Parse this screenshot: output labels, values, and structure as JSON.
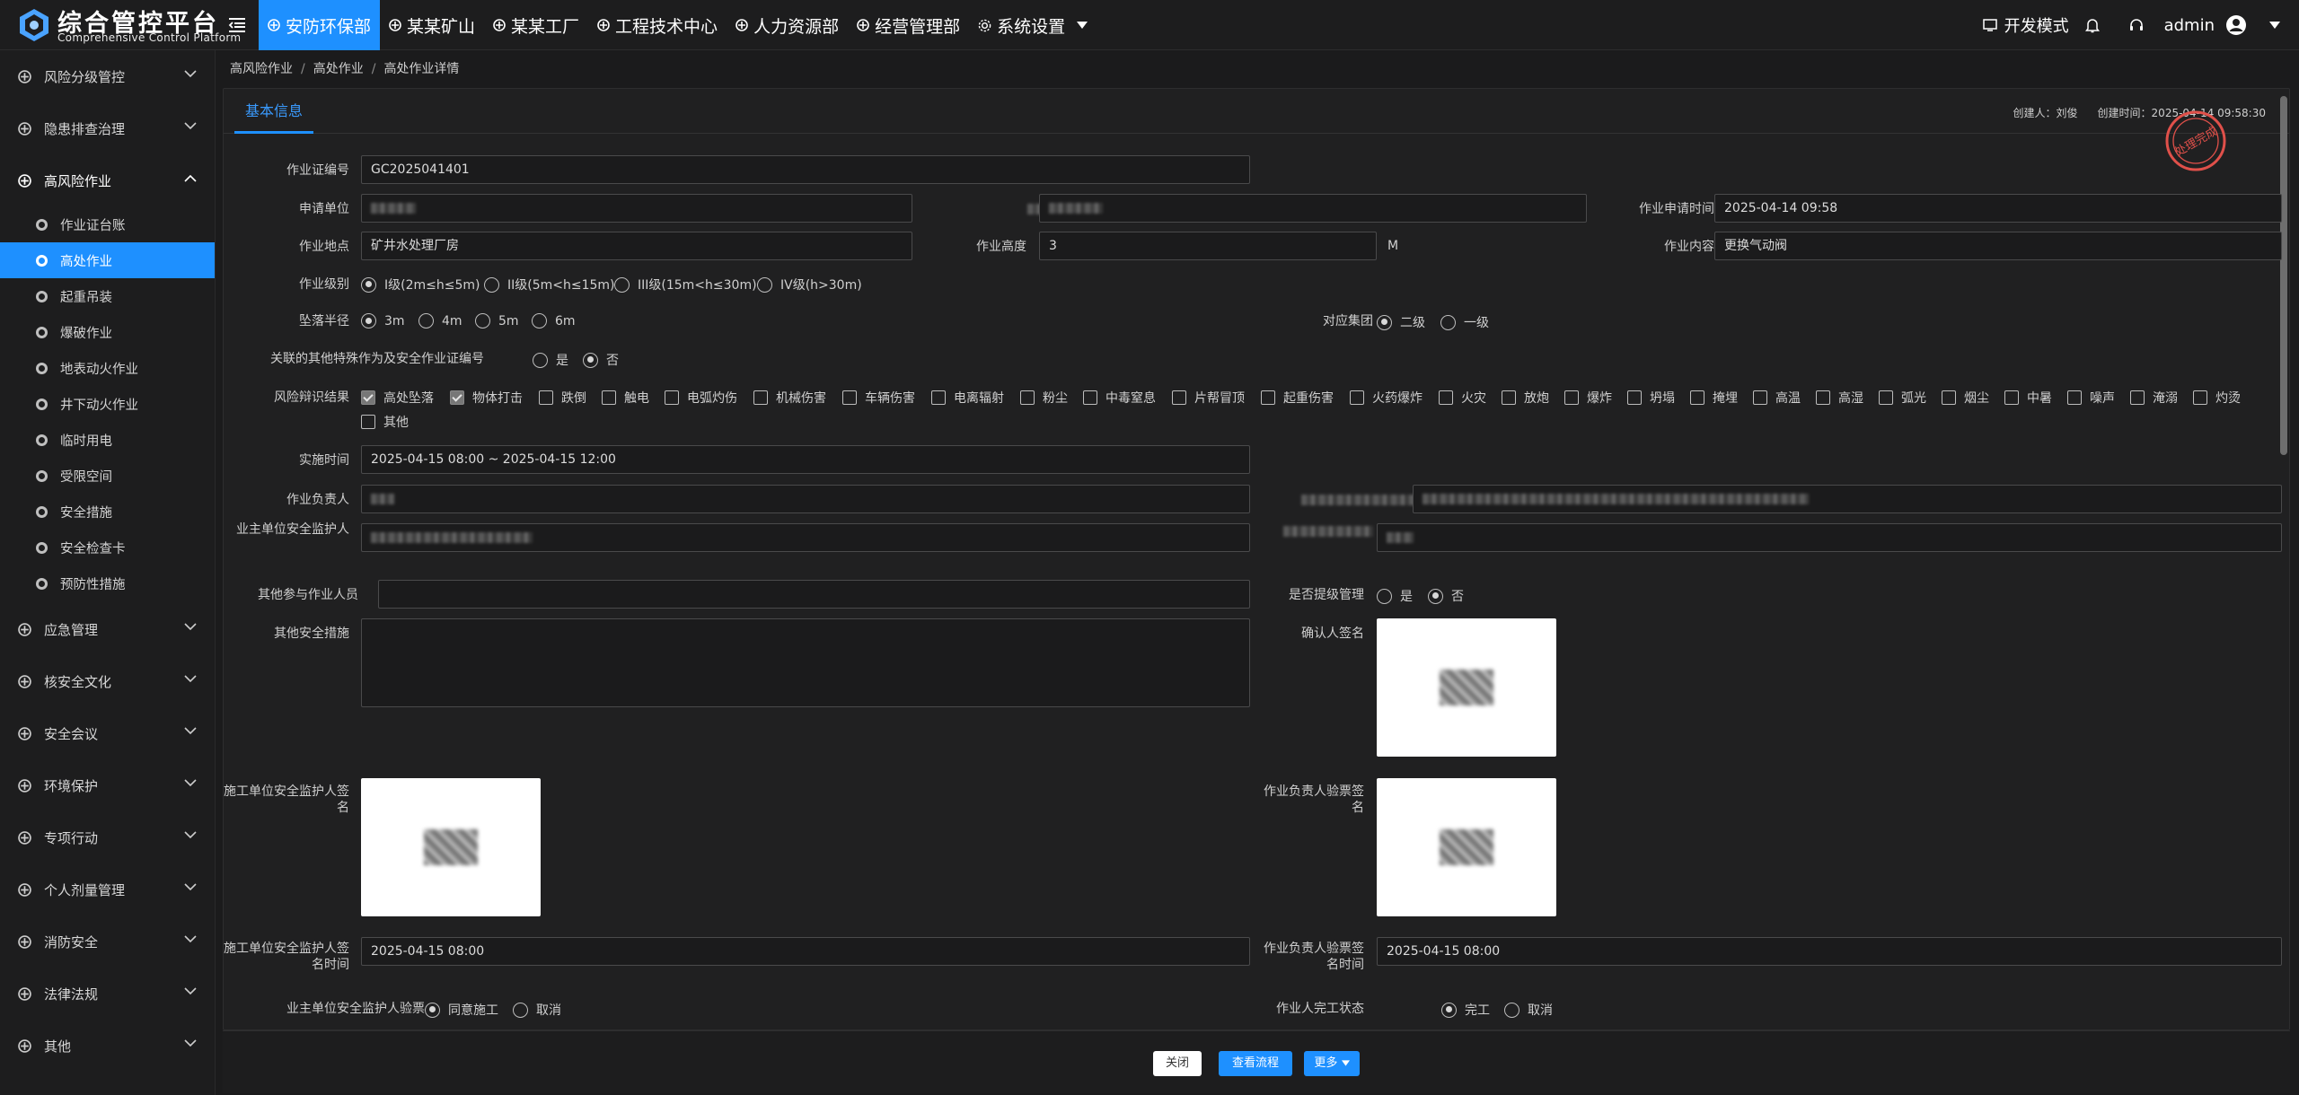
{
  "app": {
    "title": "综合管控平台",
    "subtitle": "Comprehensive Control Platform"
  },
  "nav": [
    {
      "label": "安防环保部",
      "active": true
    },
    {
      "label": "某某矿山"
    },
    {
      "label": "某某工厂"
    },
    {
      "label": "工程技术中心"
    },
    {
      "label": "人力资源部"
    },
    {
      "label": "经营管理部"
    },
    {
      "label": "系统设置"
    }
  ],
  "topright": {
    "dev_mode": "开发模式",
    "user": "admin"
  },
  "sidebar": {
    "groups_top": [
      "风险分级管控",
      "隐患排查治理",
      "高风险作业"
    ],
    "items": [
      "作业证台账",
      "高处作业",
      "起重吊装",
      "爆破作业",
      "地表动火作业",
      "井下动火作业",
      "临时用电",
      "受限空间",
      "安全措施",
      "安全检查卡",
      "预防性措施"
    ],
    "groups_bottom": [
      "应急管理",
      "核安全文化",
      "安全会议",
      "环境保护",
      "专项行动",
      "个人剂量管理",
      "消防安全",
      "法律法规",
      "其他"
    ]
  },
  "breadcrumb": [
    "高风险作业",
    "高处作业",
    "高处作业详情"
  ],
  "tab": "基本信息",
  "meta": {
    "creator": "创建人：刘俊",
    "created": "创建时间：2025-04-14 09:58:30"
  },
  "stamp": "处理完成",
  "form": {
    "cert_no": {
      "label": "作业证编号",
      "value": "GC2025041401"
    },
    "apply_unit": {
      "label": "申请单位"
    },
    "apply_time": {
      "label": "作业申请时间",
      "value": "2025-04-14 09:58"
    },
    "location": {
      "label": "作业地点",
      "value": "矿井水处理厂房"
    },
    "height": {
      "label": "作业高度",
      "value": "3",
      "unit": "M"
    },
    "content": {
      "label": "作业内容",
      "value": "更换气动阀"
    },
    "level": {
      "label": "作业级别",
      "options": [
        "I级(2m≤h≤5m)",
        "II级(5m<h≤15m)",
        "III级(15m<h≤30m)",
        "IV级(h>30m)"
      ]
    },
    "radius": {
      "label": "坠落半径",
      "options": [
        "3m",
        "4m",
        "5m",
        "6m"
      ]
    },
    "group": {
      "label": "对应集团",
      "options": [
        "二级",
        "一级"
      ]
    },
    "related": {
      "label": "关联的其他特殊作为及安全作业证编号",
      "options": [
        "是",
        "否"
      ]
    },
    "risk": {
      "label": "风险辩识结果",
      "options": [
        "高处坠落",
        "物体打击",
        "跌倒",
        "触电",
        "电弧灼伤",
        "机械伤害",
        "车辆伤害",
        "电离辐射",
        "粉尘",
        "中毒窒息",
        "片帮冒顶",
        "起重伤害",
        "火药爆炸",
        "火灾",
        "放炮",
        "爆炸",
        "坍塌",
        "掩埋",
        "高温",
        "高湿",
        "弧光",
        "烟尘",
        "中暑",
        "噪声",
        "淹溺",
        "灼烫",
        "其他"
      ]
    },
    "impl_time": {
      "label": "实施时间",
      "value": "2025-04-15 08:00 ~ 2025-04-15 12:00"
    },
    "leader": {
      "label": "作业负责人"
    },
    "owner_guard": {
      "label": "业主单位安全监护人"
    },
    "others": {
      "label": "其他参与作业人员"
    },
    "upgrade": {
      "label": "是否提级管理",
      "options": [
        "是",
        "否"
      ]
    },
    "other_measures": {
      "label": "其他安全措施"
    },
    "confirm_sign": {
      "label": "确认人签名"
    },
    "constr_sign": {
      "label": "施工单位安全监护人签名"
    },
    "leader_sign": {
      "label": "作业负责人验票签名"
    },
    "constr_sign_time": {
      "label": "施工单位安全监护人签名时间",
      "value": "2025-04-15 08:00"
    },
    "leader_sign_time": {
      "label": "作业负责人验票签名时间",
      "value": "2025-04-15 08:00"
    },
    "owner_check": {
      "label": "业主单位安全监护人验票",
      "options": [
        "同意施工",
        "取消"
      ]
    },
    "finish": {
      "label": "作业人完工状态",
      "options": [
        "完工",
        "取消"
      ]
    }
  },
  "footer": {
    "close": "关闭",
    "flow": "查看流程",
    "more": "更多"
  }
}
